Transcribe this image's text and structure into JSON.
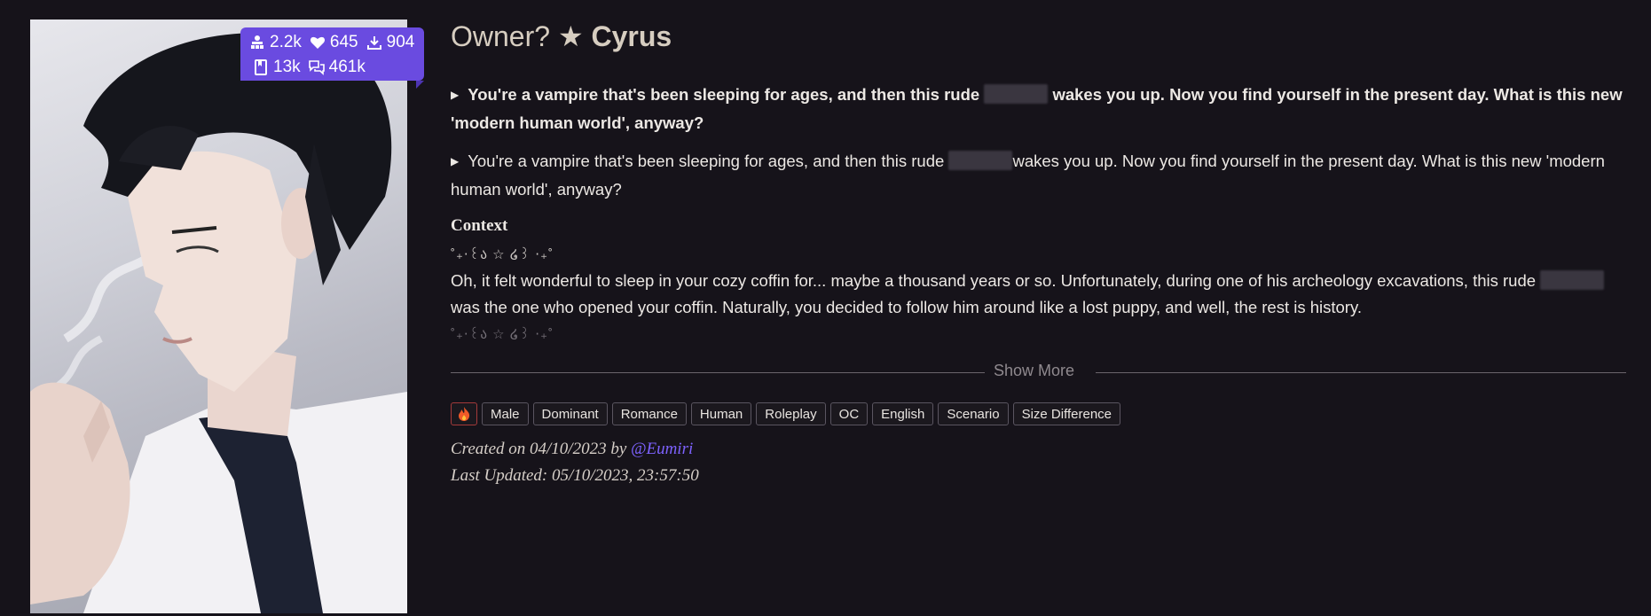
{
  "stats": {
    "chats": "2.2k",
    "likes": "645",
    "downloads": "904",
    "messages": "13k",
    "tokens": "461k"
  },
  "title": {
    "prefix": "Owner? ★",
    "name": "Cyrus"
  },
  "tagline_bold": {
    "before": "You're a vampire that's been sleeping for ages, and then this rude",
    "after": "wakes you up. Now you find yourself in the present day. What is this new 'modern human world', anyway?"
  },
  "tagline_plain": {
    "before": "You're a vampire that's been sleeping for ages, and then this rude",
    "after": "wakes you up. Now you find yourself in the present day. What is this new 'modern human world', anyway?"
  },
  "context": {
    "heading": "Context",
    "divider": "˚₊‧꒰ა ☆ ໒꒱ ‧₊˚",
    "body_before": "Oh, it felt wonderful to sleep in your cozy coffin for... maybe a thousand years or so. Unfortunately, during one of his archeology excavations, this rude",
    "body_after": "was the one who opened your coffin. Naturally, you decided to follow him around like a lost puppy, and well, the rest is history."
  },
  "show_more": "Show More",
  "tags": [
    "Male",
    "Dominant",
    "Romance",
    "Human",
    "Roleplay",
    "OC",
    "English",
    "Scenario",
    "Size Difference"
  ],
  "meta": {
    "created_prefix": "Created on 04/10/2023 by",
    "author": "@Eumiri",
    "updated": "Last Updated: 05/10/2023, 23:57:50"
  },
  "colors": {
    "background": "#16131a",
    "accent": "#6a4be0",
    "link": "#7d62ff",
    "title": "#d6cdc0"
  },
  "icons": [
    "users-icon",
    "heart-icon",
    "download-icon",
    "book-icon",
    "chat-icon",
    "fire-icon"
  ]
}
